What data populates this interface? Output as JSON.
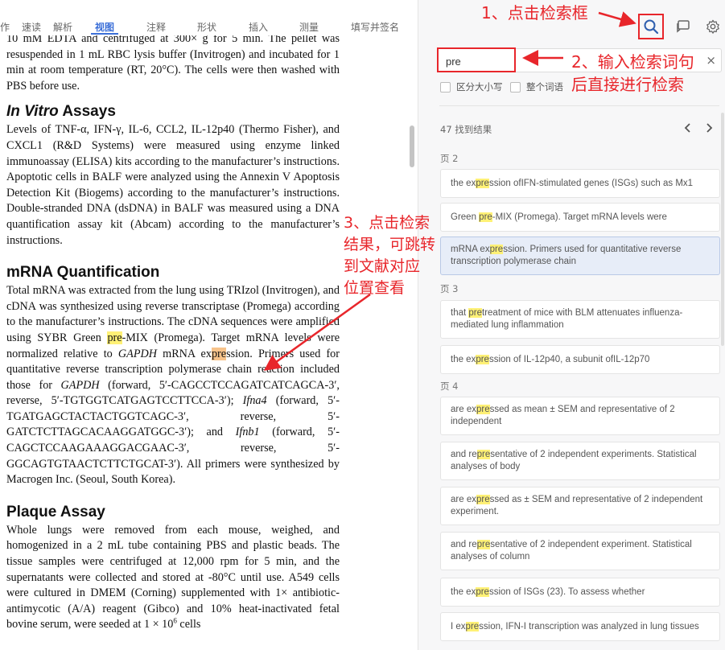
{
  "toolbar": {
    "items": [
      "作",
      "速读",
      "解析",
      "视图",
      "注释",
      "形状",
      "插入",
      "测量",
      "填写并签名"
    ],
    "active": "视图"
  },
  "document": {
    "p0": "10 mM EDTA and centrifuged at 300× g for 5 min. The pellet was resuspended in 1 mL RBC lysis buffer (Invitrogen) and incubated for 1 min at room temperature (RT, 20°C). The cells were then washed with PBS before use.",
    "h1_italic": "In Vitro",
    "h1_rest": " Assays",
    "p1": "Levels of TNF-α, IFN-γ, IL-6, CCL2, IL-12p40 (Thermo Fisher), and CXCL1 (R&D Systems) were measured using enzyme linked immunoassay (ELISA) kits according to the manufacturer’s instructions. Apoptotic cells in BALF were analyzed using the Annexin V Apoptosis Detection Kit (Biogems) according to the manufacturer’s instructions. Double-stranded DNA (dsDNA) in BALF was measured using a DNA quantification assay kit (Abcam) according to the manufacturer’s instructions.",
    "h2": "mRNA Quantification",
    "p2": {
      "a": "Total mRNA was extracted from the lung using TRIzol (Invitrogen), and cDNA was synthesized using reverse transcriptase (Promega) according to the manufacturer’s instructions. The cDNA sequences were amplified using SYBR Green ",
      "hl1": "pre",
      "b": "-MIX (Promega). Target mRNA levels were normalized relative to ",
      "gapdh": "GAPDH",
      "c": " mRNA ex",
      "hl2": "pre",
      "d": "ssion. Primers used for quantitative reverse transcription polymerase chain reaction included those for ",
      "gapdh2": "GAPDH",
      "e": " (forward, 5′-CAGCCTCCAGATCATCAGCA-3′, reverse, 5′-TGTGGTCATGAGTCCTTCCA-3′); ",
      "ifna4": "Ifna4",
      "f": " (forward, 5′-TGATGAGCTACTACTGGTCAGC-3′, reverse, 5′-GATCTCTTAGCACAAGGATGGC-3′); and ",
      "ifnb1": "Ifnb1",
      "g": " (forward, 5′-CAGCTCCAAGAAAGGACGAAC-3′, reverse, 5′-GGCAGTGTAACTCTTCTGCAT-3′). All primers were synthesized by Macrogen Inc. (Seoul, South Korea)."
    },
    "h3": "Plaque Assay",
    "p3_a": "Whole lungs were removed from each mouse, weighed, and homogenized in a 2 mL tube containing PBS and plastic beads. The tissue samples were centrifuged at 12,000 rpm for 5 min, and the supernatants were collected and stored at -80°C until use. A549 cells were cultured in DMEM (Corning) supplemented with 1× antibiotic-antimycotic (A/A) reagent (Gibco) and 10% heat-inactivated fetal bovine serum, were seeded at 1 × 10",
    "p3_sup": "6",
    "p3_b": " cells"
  },
  "search": {
    "value": "pre",
    "clear": "×",
    "case_label": "区分大小写",
    "word_label": "整个词语",
    "count": "47 找到结果",
    "prev": "‹",
    "next": "›"
  },
  "pages": [
    "页 2",
    "页 3",
    "页 4"
  ],
  "results": [
    {
      "pre": "the ex",
      "hl": "pre",
      "post": "ssion ofIFN-stimulated genes (ISGs) such as Mx1"
    },
    {
      "pre": "Green ",
      "hl": "pre",
      "post": "-MIX (Promega). Target mRNA levels were"
    },
    {
      "pre": "mRNA ex",
      "hl": "pre",
      "post": "ssion. Primers used for quantitative reverse transcription polymerase chain"
    },
    {
      "pre": "that ",
      "hl": "pre",
      "post": "treatment of mice with BLM attenuates influenza-mediated lung inflammation"
    },
    {
      "pre": "the ex",
      "hl": "pre",
      "post": "ssion of IL-12p40, a subunit ofIL-12p70"
    },
    {
      "pre": "are ex",
      "hl": "pre",
      "post": "ssed as mean ± SEM and representative of 2 independent"
    },
    {
      "pre": "and re",
      "hl": "pre",
      "post": "sentative of 2 independent experiments. Statistical analyses of body"
    },
    {
      "pre": "are ex",
      "hl": "pre",
      "post": "ssed as ± SEM and representative of 2 independent experiment."
    },
    {
      "pre": "and re",
      "hl": "pre",
      "post": "sentative of 2 independent experiment. Statistical analyses of column"
    },
    {
      "pre": "the ex",
      "hl": "pre",
      "post": "ssion of ISGs (23). To assess whether"
    },
    {
      "pre": "I ex",
      "hl": "pre",
      "post": "ssion, IFN-I transcription was analyzed in lung tissues"
    }
  ],
  "annotations": {
    "a1": "1、点击检索框",
    "a2": "2、输入检索词句",
    "a2b": "后直接进行检索",
    "a3_l1": "3、点击检索",
    "a3_l2": "结果，可跳转",
    "a3_l3": "到文献对应",
    "a3_l4": "位置查看"
  },
  "colors": {
    "accent": "#3b6fd8",
    "annotation": "#e8262b",
    "highlight": "#fff176",
    "current_highlight": "#f7c38a"
  },
  "icons": [
    "search-icon",
    "comment-icon",
    "gear-icon",
    "chevron-left-icon",
    "chevron-right-icon",
    "close-icon",
    "splitter-icon"
  ],
  "splitter": "||"
}
